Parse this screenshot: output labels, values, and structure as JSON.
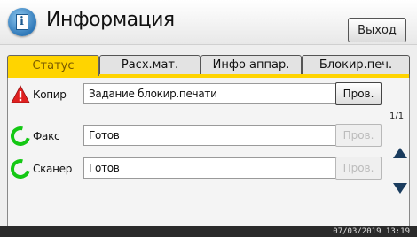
{
  "header": {
    "title": "Информация",
    "exit_label": "Выход",
    "app_icon_glyph": "i"
  },
  "tabs": [
    {
      "label": "Статус",
      "active": true
    },
    {
      "label": "Расх.мат.",
      "active": false
    },
    {
      "label": "Инфо аппар.",
      "active": false
    },
    {
      "label": "Блокир.печ.",
      "active": false
    }
  ],
  "devices": [
    {
      "name": "Копир",
      "message": "Задание блокир.печати",
      "check_label": "Пров.",
      "check_enabled": true,
      "status_icon": "warning-icon"
    },
    {
      "name": "Факс",
      "message": "Готов",
      "check_label": "Пров.",
      "check_enabled": false,
      "status_icon": "ready-ring-icon"
    },
    {
      "name": "Сканер",
      "message": "Готов",
      "check_label": "Пров.",
      "check_enabled": false,
      "status_icon": "ready-ring-icon"
    }
  ],
  "pagination": {
    "text": "1/1"
  },
  "status_bar": {
    "datetime": "07/03/2019 13:19"
  },
  "colors": {
    "active_tab": "#ffd400",
    "warning": "#e02020",
    "ready": "#14c814"
  }
}
